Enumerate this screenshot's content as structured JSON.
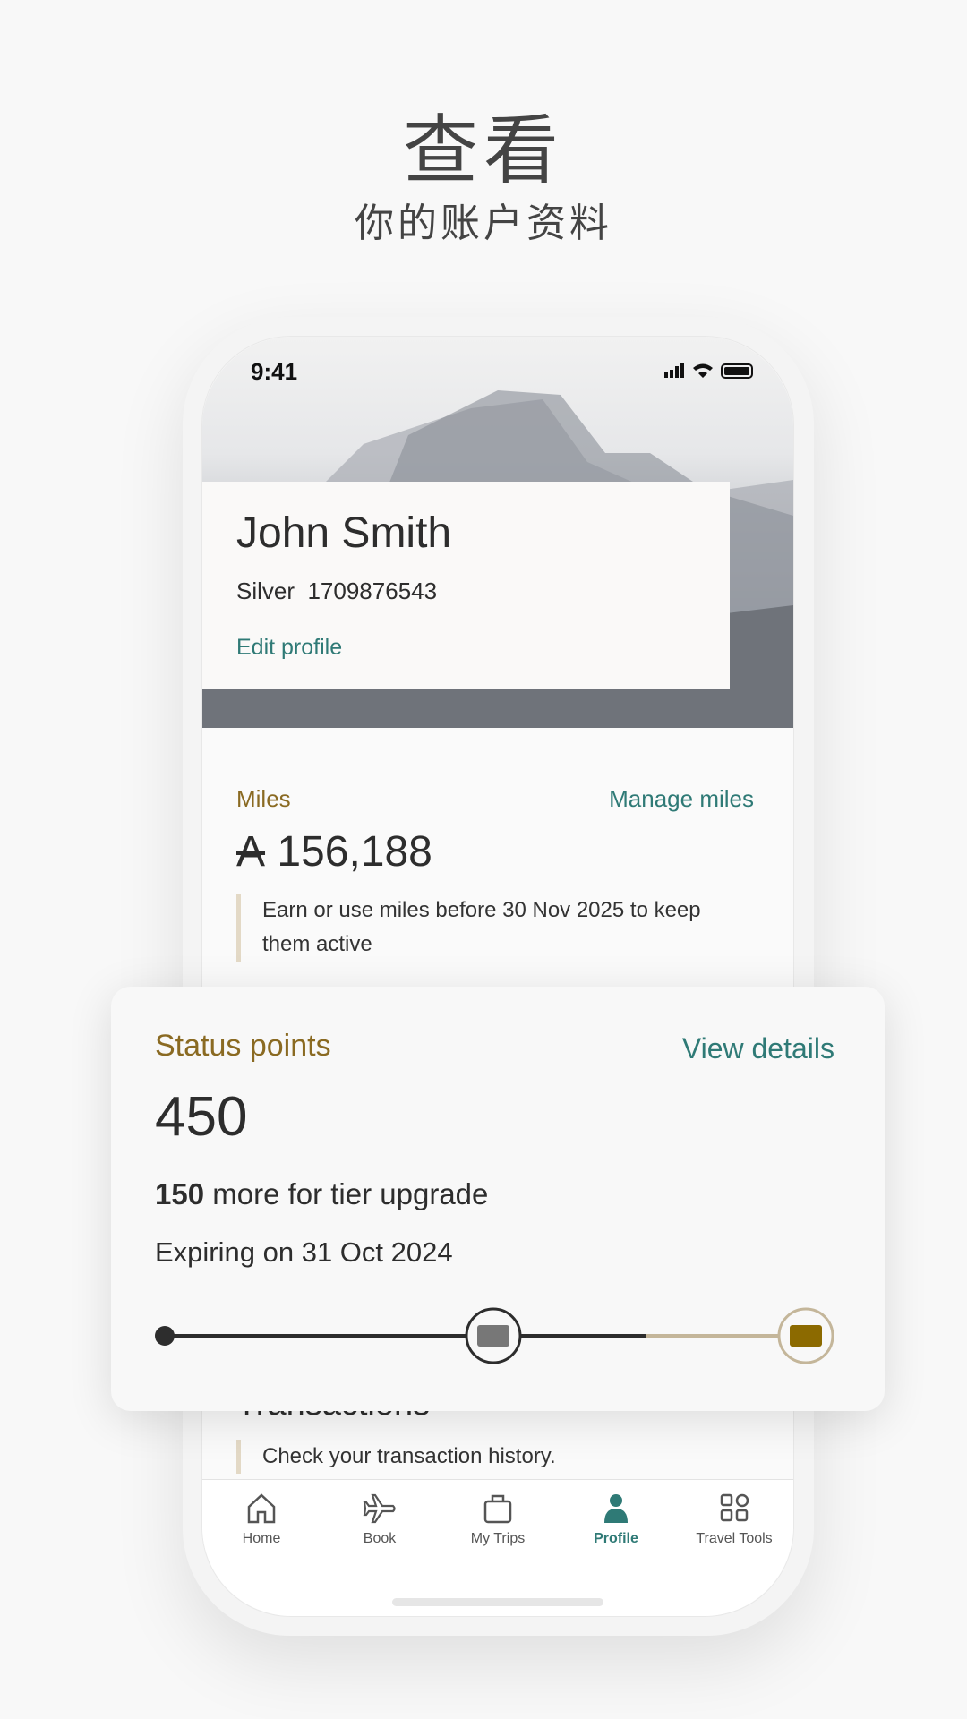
{
  "promo": {
    "title": "查看",
    "subtitle": "你的账户资料"
  },
  "status_bar": {
    "time": "9:41",
    "icons": [
      "signal-icon",
      "wifi-icon",
      "battery-icon"
    ]
  },
  "profile": {
    "name": "John Smith",
    "tier": "Silver",
    "member_number": "1709876543",
    "edit_label": "Edit profile"
  },
  "miles": {
    "label": "Miles",
    "manage_label": "Manage miles",
    "symbol": "A",
    "value": "156,188",
    "note": "Earn or use miles before 30 Nov 2025 to keep them active"
  },
  "status_points": {
    "label": "Status points",
    "details_label": "View details",
    "value": "450",
    "more_value": "150",
    "more_text": " more for tier upgrade",
    "expiry": "Expiring on 31 Oct 2024",
    "progress_fraction": 0.75
  },
  "transactions": {
    "heading": "Transactions",
    "note": "Check your transaction history."
  },
  "tabs": [
    {
      "label": "Home",
      "icon": "home-icon",
      "active": false
    },
    {
      "label": "Book",
      "icon": "plane-icon",
      "active": false
    },
    {
      "label": "My Trips",
      "icon": "suitcase-icon",
      "active": false
    },
    {
      "label": "Profile",
      "icon": "person-icon",
      "active": true
    },
    {
      "label": "Travel Tools",
      "icon": "grid-icon",
      "active": false
    }
  ],
  "colors": {
    "teal": "#2f7a76",
    "gold": "#8a6a22",
    "gold_card": "#8c6a00",
    "silver_card": "#777777",
    "track_remaining": "#c4b69a"
  }
}
